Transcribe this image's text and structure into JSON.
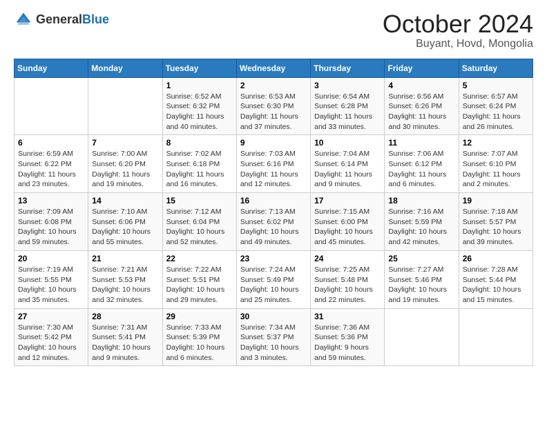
{
  "header": {
    "logo_general": "General",
    "logo_blue": "Blue",
    "title": "October 2024",
    "location": "Buyant, Hovd, Mongolia"
  },
  "days_of_week": [
    "Sunday",
    "Monday",
    "Tuesday",
    "Wednesday",
    "Thursday",
    "Friday",
    "Saturday"
  ],
  "weeks": [
    [
      {
        "day": "",
        "sunrise": "",
        "sunset": "",
        "daylight": ""
      },
      {
        "day": "",
        "sunrise": "",
        "sunset": "",
        "daylight": ""
      },
      {
        "day": "1",
        "sunrise": "Sunrise: 6:52 AM",
        "sunset": "Sunset: 6:32 PM",
        "daylight": "Daylight: 11 hours and 40 minutes."
      },
      {
        "day": "2",
        "sunrise": "Sunrise: 6:53 AM",
        "sunset": "Sunset: 6:30 PM",
        "daylight": "Daylight: 11 hours and 37 minutes."
      },
      {
        "day": "3",
        "sunrise": "Sunrise: 6:54 AM",
        "sunset": "Sunset: 6:28 PM",
        "daylight": "Daylight: 11 hours and 33 minutes."
      },
      {
        "day": "4",
        "sunrise": "Sunrise: 6:56 AM",
        "sunset": "Sunset: 6:26 PM",
        "daylight": "Daylight: 11 hours and 30 minutes."
      },
      {
        "day": "5",
        "sunrise": "Sunrise: 6:57 AM",
        "sunset": "Sunset: 6:24 PM",
        "daylight": "Daylight: 11 hours and 26 minutes."
      }
    ],
    [
      {
        "day": "6",
        "sunrise": "Sunrise: 6:59 AM",
        "sunset": "Sunset: 6:22 PM",
        "daylight": "Daylight: 11 hours and 23 minutes."
      },
      {
        "day": "7",
        "sunrise": "Sunrise: 7:00 AM",
        "sunset": "Sunset: 6:20 PM",
        "daylight": "Daylight: 11 hours and 19 minutes."
      },
      {
        "day": "8",
        "sunrise": "Sunrise: 7:02 AM",
        "sunset": "Sunset: 6:18 PM",
        "daylight": "Daylight: 11 hours and 16 minutes."
      },
      {
        "day": "9",
        "sunrise": "Sunrise: 7:03 AM",
        "sunset": "Sunset: 6:16 PM",
        "daylight": "Daylight: 11 hours and 12 minutes."
      },
      {
        "day": "10",
        "sunrise": "Sunrise: 7:04 AM",
        "sunset": "Sunset: 6:14 PM",
        "daylight": "Daylight: 11 hours and 9 minutes."
      },
      {
        "day": "11",
        "sunrise": "Sunrise: 7:06 AM",
        "sunset": "Sunset: 6:12 PM",
        "daylight": "Daylight: 11 hours and 6 minutes."
      },
      {
        "day": "12",
        "sunrise": "Sunrise: 7:07 AM",
        "sunset": "Sunset: 6:10 PM",
        "daylight": "Daylight: 11 hours and 2 minutes."
      }
    ],
    [
      {
        "day": "13",
        "sunrise": "Sunrise: 7:09 AM",
        "sunset": "Sunset: 6:08 PM",
        "daylight": "Daylight: 10 hours and 59 minutes."
      },
      {
        "day": "14",
        "sunrise": "Sunrise: 7:10 AM",
        "sunset": "Sunset: 6:06 PM",
        "daylight": "Daylight: 10 hours and 55 minutes."
      },
      {
        "day": "15",
        "sunrise": "Sunrise: 7:12 AM",
        "sunset": "Sunset: 6:04 PM",
        "daylight": "Daylight: 10 hours and 52 minutes."
      },
      {
        "day": "16",
        "sunrise": "Sunrise: 7:13 AM",
        "sunset": "Sunset: 6:02 PM",
        "daylight": "Daylight: 10 hours and 49 minutes."
      },
      {
        "day": "17",
        "sunrise": "Sunrise: 7:15 AM",
        "sunset": "Sunset: 6:00 PM",
        "daylight": "Daylight: 10 hours and 45 minutes."
      },
      {
        "day": "18",
        "sunrise": "Sunrise: 7:16 AM",
        "sunset": "Sunset: 5:59 PM",
        "daylight": "Daylight: 10 hours and 42 minutes."
      },
      {
        "day": "19",
        "sunrise": "Sunrise: 7:18 AM",
        "sunset": "Sunset: 5:57 PM",
        "daylight": "Daylight: 10 hours and 39 minutes."
      }
    ],
    [
      {
        "day": "20",
        "sunrise": "Sunrise: 7:19 AM",
        "sunset": "Sunset: 5:55 PM",
        "daylight": "Daylight: 10 hours and 35 minutes."
      },
      {
        "day": "21",
        "sunrise": "Sunrise: 7:21 AM",
        "sunset": "Sunset: 5:53 PM",
        "daylight": "Daylight: 10 hours and 32 minutes."
      },
      {
        "day": "22",
        "sunrise": "Sunrise: 7:22 AM",
        "sunset": "Sunset: 5:51 PM",
        "daylight": "Daylight: 10 hours and 29 minutes."
      },
      {
        "day": "23",
        "sunrise": "Sunrise: 7:24 AM",
        "sunset": "Sunset: 5:49 PM",
        "daylight": "Daylight: 10 hours and 25 minutes."
      },
      {
        "day": "24",
        "sunrise": "Sunrise: 7:25 AM",
        "sunset": "Sunset: 5:48 PM",
        "daylight": "Daylight: 10 hours and 22 minutes."
      },
      {
        "day": "25",
        "sunrise": "Sunrise: 7:27 AM",
        "sunset": "Sunset: 5:46 PM",
        "daylight": "Daylight: 10 hours and 19 minutes."
      },
      {
        "day": "26",
        "sunrise": "Sunrise: 7:28 AM",
        "sunset": "Sunset: 5:44 PM",
        "daylight": "Daylight: 10 hours and 15 minutes."
      }
    ],
    [
      {
        "day": "27",
        "sunrise": "Sunrise: 7:30 AM",
        "sunset": "Sunset: 5:42 PM",
        "daylight": "Daylight: 10 hours and 12 minutes."
      },
      {
        "day": "28",
        "sunrise": "Sunrise: 7:31 AM",
        "sunset": "Sunset: 5:41 PM",
        "daylight": "Daylight: 10 hours and 9 minutes."
      },
      {
        "day": "29",
        "sunrise": "Sunrise: 7:33 AM",
        "sunset": "Sunset: 5:39 PM",
        "daylight": "Daylight: 10 hours and 6 minutes."
      },
      {
        "day": "30",
        "sunrise": "Sunrise: 7:34 AM",
        "sunset": "Sunset: 5:37 PM",
        "daylight": "Daylight: 10 hours and 3 minutes."
      },
      {
        "day": "31",
        "sunrise": "Sunrise: 7:36 AM",
        "sunset": "Sunset: 5:36 PM",
        "daylight": "Daylight: 9 hours and 59 minutes."
      },
      {
        "day": "",
        "sunrise": "",
        "sunset": "",
        "daylight": ""
      },
      {
        "day": "",
        "sunrise": "",
        "sunset": "",
        "daylight": ""
      }
    ]
  ]
}
